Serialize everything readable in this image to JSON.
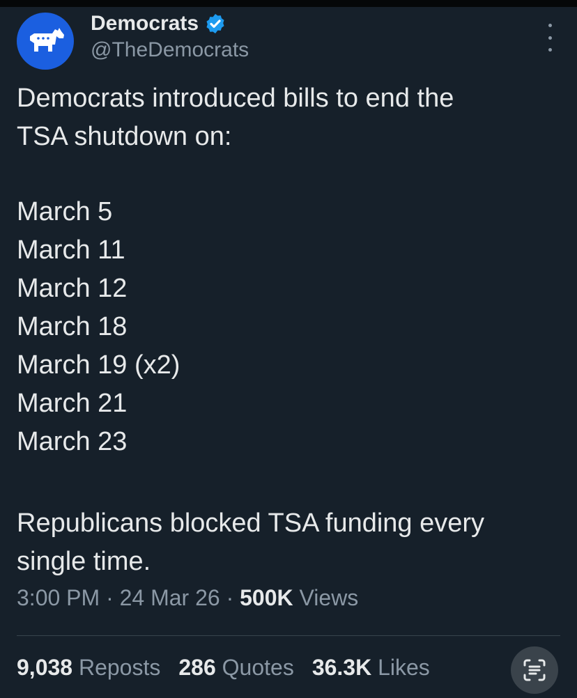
{
  "account": {
    "display_name": "Democrats",
    "handle": "@TheDemocrats",
    "avatar_icon": "donkey-logo-icon",
    "verified_icon": "verified-badge-icon",
    "brand_color": "#1b5fe0",
    "verified_color": "#1d9bf0"
  },
  "tweet": {
    "intro_line1": "Democrats introduced bills to end the",
    "intro_line2": "TSA shutdown on:",
    "dates": [
      "March 5",
      "March 11",
      "March 12",
      "March 18",
      "March 19 (x2)",
      "March 21",
      "March 23"
    ],
    "closing_line1": "Republicans blocked TSA funding every",
    "closing_line2": "single time."
  },
  "meta": {
    "time": "3:00 PM",
    "separator": "·",
    "date": "24 Mar 26",
    "views_count": "500K",
    "views_label": "Views"
  },
  "stats": {
    "reposts_count": "9,038",
    "reposts_label": "Reposts",
    "quotes_count": "286",
    "quotes_label": "Quotes",
    "likes_count": "36.3K",
    "likes_label": "Likes"
  },
  "icons": {
    "more": "more-options-icon",
    "lens": "scan-text-icon"
  }
}
